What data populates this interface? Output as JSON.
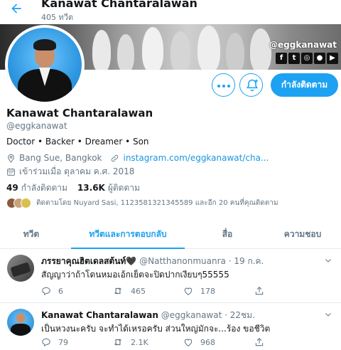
{
  "header": {
    "name": "Kanawat Chantaralawan",
    "tweet_count": "405 ทวีต"
  },
  "banner": {
    "handle": "@eggkanawat",
    "social": [
      "f",
      "t",
      "◎",
      "●",
      "▶"
    ]
  },
  "actions": {
    "follow_label": "กำลังติดตาม"
  },
  "profile": {
    "name": "Kanawat Chantaralawan",
    "handle": "@eggkanawat",
    "bio": "Doctor • Backer • Dreamer • Son",
    "location": "Bang Sue, Bangkok",
    "link": "instagram.com/eggkanawat/cha...",
    "joined": "เข้าร่วมเมื่อ ตุลาคม ค.ศ. 2018",
    "following_count": "49",
    "following_label": "กำลังติดตาม",
    "followers_count": "13.6K",
    "followers_label": "ผู้ติดตาม",
    "followed_by": "ติดตามโดย Nuyard Sasi, 1123581321345589 และอีก 20 คนที่คุณติดตาม"
  },
  "tabs": [
    {
      "label": "ทวีต"
    },
    {
      "label": "ทวีตและการตอบกลับ"
    },
    {
      "label": "สื่อ"
    },
    {
      "label": "ความชอบ"
    }
  ],
  "tweets": [
    {
      "name": "ภรรยาคุณฮิตเดลสต้นท์🖤",
      "handle": "@Natthanonmuanra",
      "time": "· 19 ก.ค.",
      "text": "สัญญาว่าถ้าโดนหมอเอ้กเย็ตจะปิดปากเงียบๆ55555",
      "replies": "6",
      "retweets": "465",
      "likes": "178"
    },
    {
      "name": "Kanawat Chantaralawan",
      "handle": "@eggkanawat",
      "time": "· 22ชม.",
      "text": "เป็นหวงนะครับ จะทำได้เหรอครับ ส่วนใหญ่มักจะ...ร้อง ขอชีวิต",
      "replies": "79",
      "retweets": "2.1K",
      "likes": "968"
    }
  ],
  "colors": {
    "accent": "#1da1f2",
    "text": "#14171a",
    "muted": "#657786",
    "border": "#e6ecf0"
  }
}
